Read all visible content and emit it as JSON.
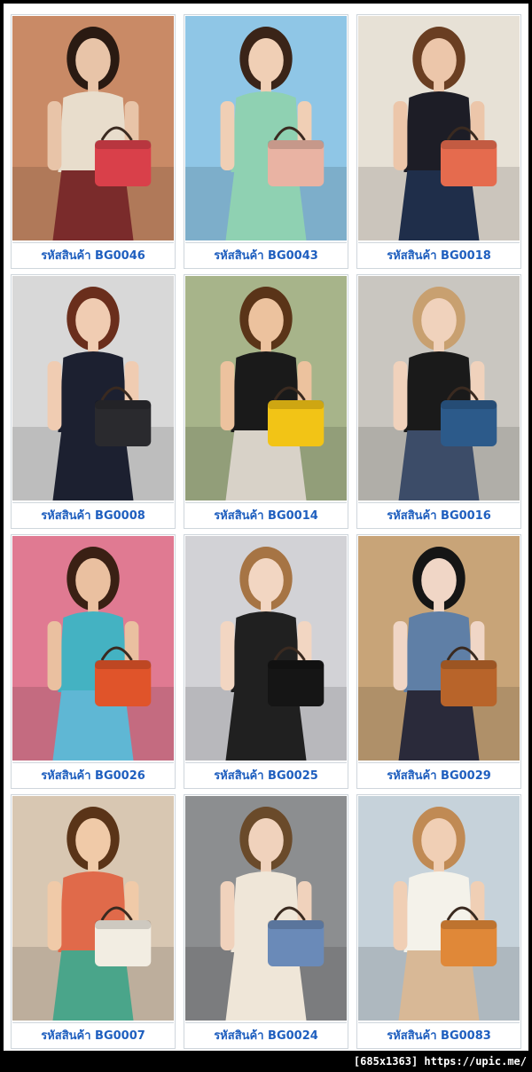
{
  "products": [
    {
      "code_label": "รหัสสินค้า BG0046",
      "bg": "#c98a66",
      "skin": "#e8c4a8",
      "hair": "#2a1a12",
      "top": "#e8ddcc",
      "bottom": "#7a2b2b",
      "bag": "#d9404a"
    },
    {
      "code_label": "รหัสสินค้า BG0043",
      "bg": "#8fc6e6",
      "skin": "#f0cfb5",
      "hair": "#3a2418",
      "top": "#8fd1b2",
      "bottom": "#8fd1b2",
      "bag": "#e9b3a3"
    },
    {
      "code_label": "รหัสสินค้า BG0018",
      "bg": "#e7e1d6",
      "skin": "#ecc6aa",
      "hair": "#6a3e22",
      "top": "#1d1d26",
      "bottom": "#1f2e4a",
      "bag": "#e56b4e"
    },
    {
      "code_label": "รหัสสินค้า BG0008",
      "bg": "#d8d8d8",
      "skin": "#f0ccb2",
      "hair": "#6a2e1c",
      "top": "#1c2030",
      "bottom": "#1c2030",
      "bag": "#2a2a2e"
    },
    {
      "code_label": "รหัสสินค้า BG0014",
      "bg": "#a7b48a",
      "skin": "#ecc29e",
      "hair": "#5a3418",
      "top": "#1a1a1a",
      "bottom": "#d8d2c8",
      "bag": "#f2c416"
    },
    {
      "code_label": "รหัสสินค้า BG0016",
      "bg": "#c9c6c0",
      "skin": "#f0d2bc",
      "hair": "#c8a070",
      "top": "#1a1a1a",
      "bottom": "#3c4c68",
      "bag": "#2c5a8a"
    },
    {
      "code_label": "รหัสสินค้า BG0026",
      "bg": "#e07a92",
      "skin": "#eac0a0",
      "hair": "#3a2014",
      "top": "#44b2c2",
      "bottom": "#5fb7d4",
      "bag": "#e0542a"
    },
    {
      "code_label": "รหัสสินค้า BG0025",
      "bg": "#d2d2d6",
      "skin": "#f2d6c2",
      "hair": "#a67444",
      "top": "#202020",
      "bottom": "#202020",
      "bag": "#151515"
    },
    {
      "code_label": "รหัสสินค้า BG0029",
      "bg": "#c8a478",
      "skin": "#f0d6c6",
      "hair": "#151515",
      "top": "#5f7fa6",
      "bottom": "#2a2a3a",
      "bag": "#b8642a"
    },
    {
      "code_label": "รหัสสินค้า BG0007",
      "bg": "#d8c7b2",
      "skin": "#f0caa8",
      "hair": "#5a3418",
      "top": "#e06a4a",
      "bottom": "#4aa58a",
      "bag": "#f2ede2"
    },
    {
      "code_label": "รหัสสินค้า BG0024",
      "bg": "#8c8e90",
      "skin": "#f0d2bc",
      "hair": "#6a4a2a",
      "top": "#efe6d8",
      "bottom": "#efe6d8",
      "bag": "#6a8ab8"
    },
    {
      "code_label": "รหัสสินค้า BG0083",
      "bg": "#c6d2da",
      "skin": "#f0cfb5",
      "hair": "#c08a54",
      "top": "#f4f2ea",
      "bottom": "#d8b896",
      "bag": "#e08838"
    }
  ],
  "footer_text": "[685x1363] https://upic.me/"
}
